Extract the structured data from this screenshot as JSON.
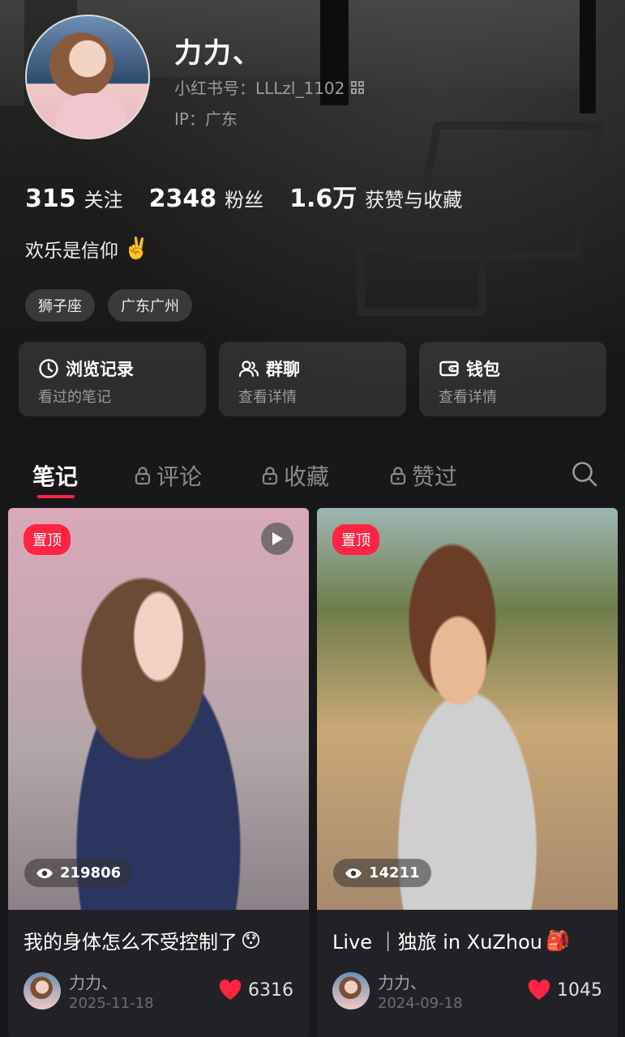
{
  "profile": {
    "name": "力力、",
    "red_id": "小红书号：LLLzl_1102",
    "ip": "IP：广东",
    "bio": "欢乐是信仰",
    "bio_emoji": "✌️",
    "tags": [
      "狮子座",
      "广东广州"
    ]
  },
  "stats": [
    {
      "num": "315",
      "label": "关注"
    },
    {
      "num": "2348",
      "label": "粉丝"
    },
    {
      "num": "1.6万",
      "label": "获赞与收藏"
    }
  ],
  "quick_cards": [
    {
      "title": "浏览记录",
      "sub": "看过的笔记",
      "icon": "clock-icon"
    },
    {
      "title": "群聊",
      "sub": "查看详情",
      "icon": "group-icon"
    },
    {
      "title": "钱包",
      "sub": "查看详情",
      "icon": "wallet-icon"
    }
  ],
  "tabs": [
    {
      "label": "笔记",
      "active": true,
      "locked": false
    },
    {
      "label": "评论",
      "active": false,
      "locked": true
    },
    {
      "label": "收藏",
      "active": false,
      "locked": true
    },
    {
      "label": "赞过",
      "active": false,
      "locked": true
    }
  ],
  "notes": [
    {
      "pin": "置顶",
      "views": "219806",
      "title": "我的身体怎么不受控制了",
      "title_emoji": "😯",
      "author": "力力、",
      "date": "2025-11-18",
      "likes": "6316",
      "is_video": true
    },
    {
      "pin": "置顶",
      "views": "14211",
      "title": "Live ｜独旅 in XuZhou",
      "title_emoji": "🎒",
      "author": "力力、",
      "date": "2024-09-18",
      "likes": "1045",
      "is_video": false
    }
  ],
  "colors": {
    "accent": "#ff2442",
    "background": "#18181b"
  }
}
